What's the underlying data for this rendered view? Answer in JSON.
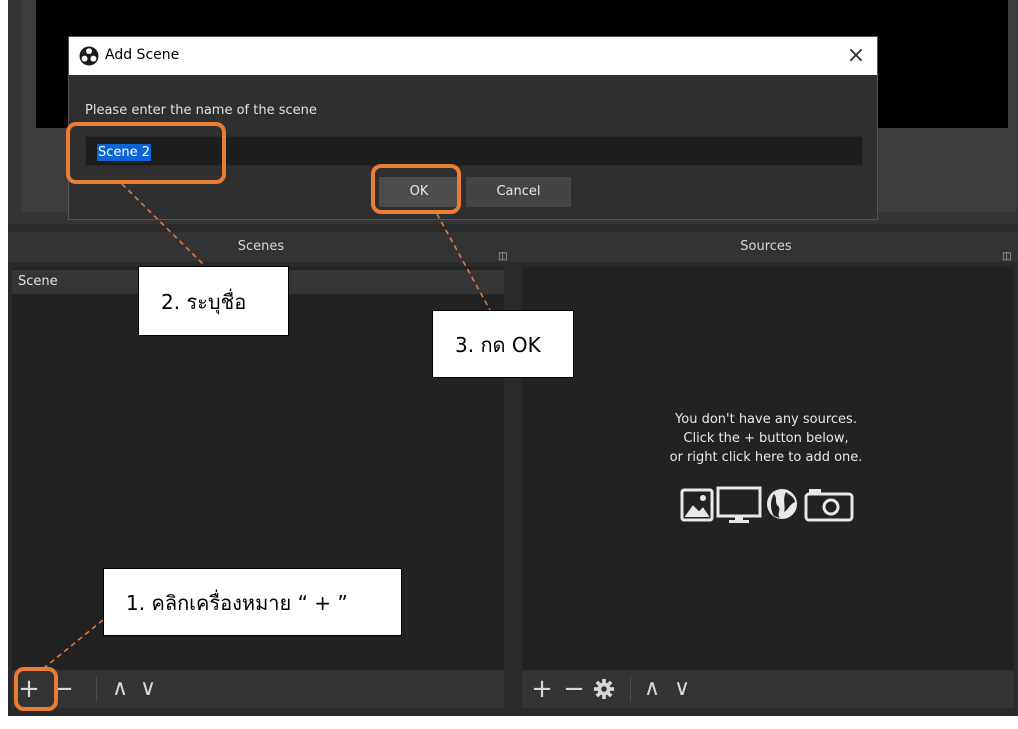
{
  "dialog": {
    "title": "Add Scene",
    "prompt": "Please enter the name of the scene",
    "input_value": "Scene 2",
    "ok_label": "OK",
    "cancel_label": "Cancel",
    "close_glyph": "×"
  },
  "scenes": {
    "title": "Scenes",
    "items": [
      "Scene"
    ],
    "toolbar": {
      "add": "+",
      "remove": "−",
      "up": "∧",
      "down": "∨"
    }
  },
  "sources": {
    "title": "Sources",
    "empty_lines": [
      "You don't have any sources.",
      "Click the + button below,",
      "or right click here to add one."
    ],
    "empty_icons": [
      "image-icon",
      "monitor-icon",
      "globe-icon",
      "camera-icon"
    ],
    "toolbar": {
      "add": "+",
      "remove": "−",
      "up": "∧",
      "down": "∨"
    }
  },
  "annotations": {
    "step1": "1. คลิกเครื่องหมาย “ + ”",
    "step2": "2. ระบุชื่อ",
    "step3": "3. กด OK"
  },
  "colors": {
    "highlight": "#ea7d33",
    "selection": "#0a64d6"
  }
}
